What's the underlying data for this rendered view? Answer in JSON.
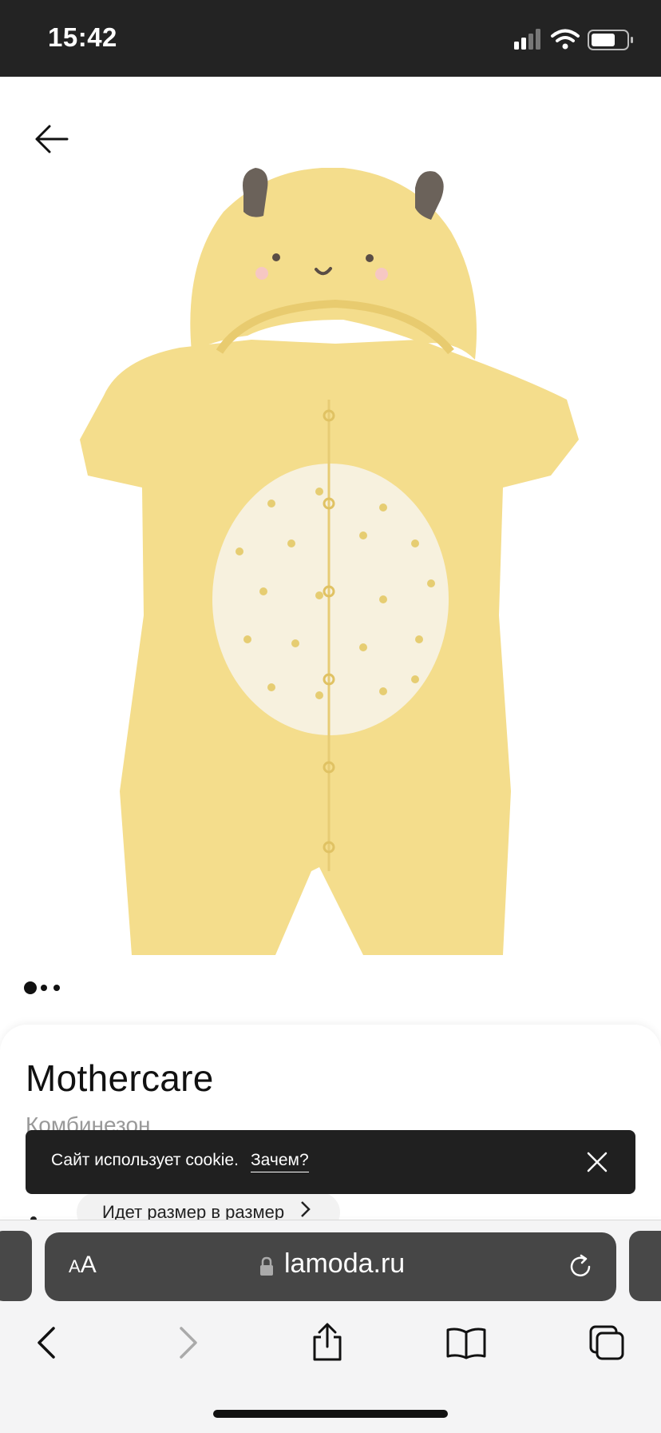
{
  "status_bar": {
    "time": "15:42"
  },
  "product": {
    "brand": "Mothercare",
    "subtitle": "Комбинезон",
    "size_note": "Идет размер в размер",
    "image_count": 3,
    "active_image": 1
  },
  "cookie_banner": {
    "text": "Сайт использует cookie.",
    "link_label": "Зачем?"
  },
  "browser": {
    "aa_label_small": "A",
    "aa_label_large": "A",
    "url": "lamoda.ru"
  },
  "icons": {
    "back": "back-arrow-icon",
    "close": "close-icon",
    "lock": "lock-icon",
    "reload": "reload-icon",
    "nav_back": "chevron-left-icon",
    "nav_forward": "chevron-right-icon",
    "share": "share-icon",
    "bookmarks": "book-icon",
    "tabs": "tabs-icon"
  },
  "colors": {
    "status_bar_bg": "#232323",
    "garment_yellow": "#f4dd8c",
    "cookie_bg": "#202020",
    "address_bar_bg": "#464646"
  }
}
